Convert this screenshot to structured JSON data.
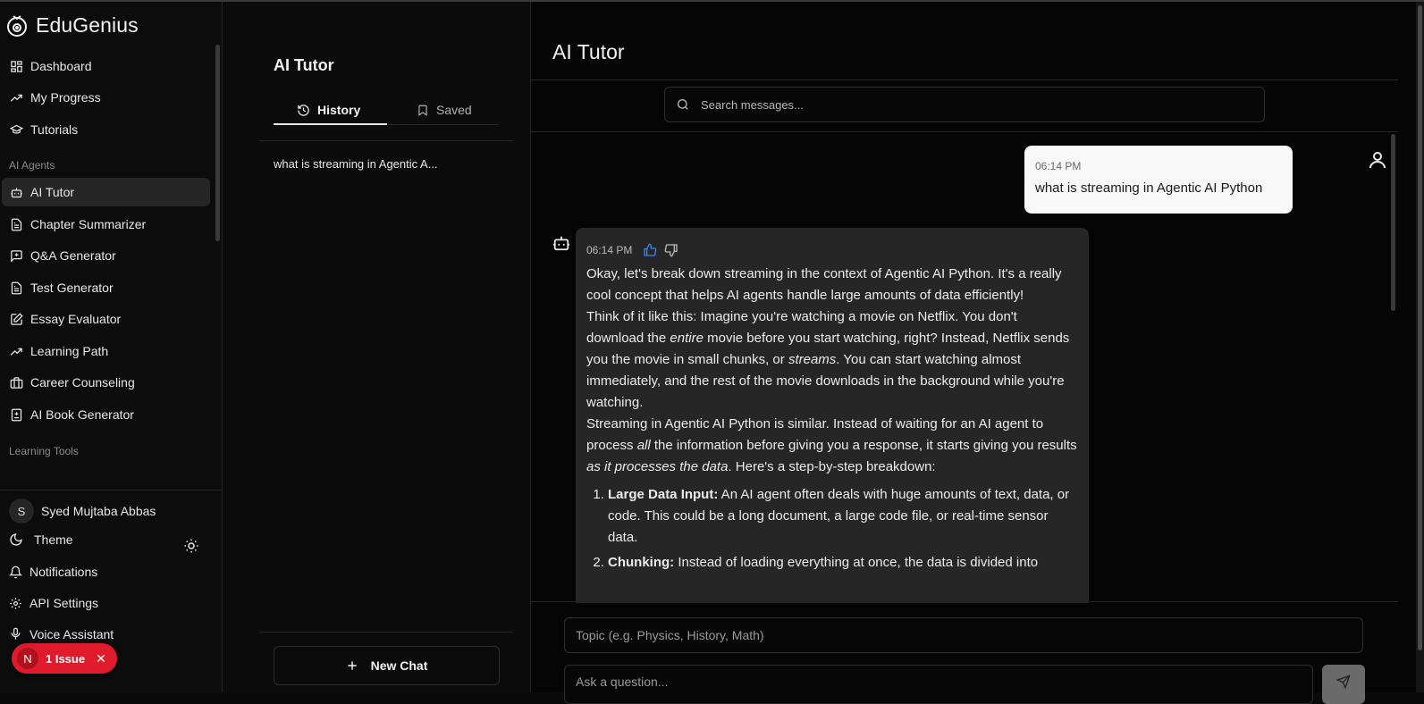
{
  "app": {
    "name": "EduGenius"
  },
  "sidebar": {
    "items_top": [
      {
        "label": "Dashboard",
        "icon": "grid-icon"
      },
      {
        "label": "My Progress",
        "icon": "trending-up-icon"
      },
      {
        "label": "Tutorials",
        "icon": "graduation-cap-icon"
      }
    ],
    "group_ai": "AI Agents",
    "items_ai": [
      {
        "label": "AI Tutor",
        "icon": "bot-icon",
        "active": true
      },
      {
        "label": "Chapter Summarizer",
        "icon": "document-icon"
      },
      {
        "label": "Q&A Generator",
        "icon": "message-plus-icon"
      },
      {
        "label": "Test Generator",
        "icon": "document-icon"
      },
      {
        "label": "Essay Evaluator",
        "icon": "pen-square-icon"
      },
      {
        "label": "Learning Path",
        "icon": "trending-up-icon"
      },
      {
        "label": "Career Counseling",
        "icon": "briefcase-icon"
      },
      {
        "label": "AI Book Generator",
        "icon": "book-plus-icon"
      }
    ],
    "group_tools": "Learning Tools",
    "user": {
      "initial": "S",
      "name": "Syed Mujtaba Abbas"
    },
    "theme_label": "Theme",
    "notifications_label": "Notifications",
    "api_settings_label": "API Settings",
    "voice_label": "Voice Assistant"
  },
  "issue_badge": {
    "initial": "N",
    "label": "1 Issue",
    "color": "#e01b2b"
  },
  "history_panel": {
    "title": "AI Tutor",
    "tabs": [
      {
        "label": "History",
        "active": true
      },
      {
        "label": "Saved"
      }
    ],
    "items": [
      "what is streaming in Agentic A..."
    ],
    "new_chat_label": "New Chat"
  },
  "chat": {
    "title": "AI Tutor",
    "search_placeholder": "Search messages...",
    "user_message": {
      "time": "06:14 PM",
      "text": "what is streaming in Agentic AI Python"
    },
    "bot_message": {
      "time": "06:14 PM",
      "p1": "Okay, let's break down streaming in the context of Agentic AI Python. It's a really cool concept that helps AI agents handle large amounts of data efficiently!",
      "p2_a": "Think of it like this: Imagine you're watching a movie on Netflix. You don't download the ",
      "p2_em1": "entire",
      "p2_b": " movie before you start watching, right? Instead, Netflix sends you the movie in small chunks, or ",
      "p2_em2": "streams",
      "p2_c": ". You can start watching almost immediately, and the rest of the movie downloads in the background while you're watching.",
      "p3_a": "Streaming in Agentic AI Python is similar. Instead of waiting for an AI agent to process ",
      "p3_em1": "all",
      "p3_b": " the information before giving you a response, it starts giving you results ",
      "p3_em2": "as it processes the data",
      "p3_c": ". Here's a step-by-step breakdown:",
      "list": [
        {
          "title": "Large Data Input:",
          "text": " An AI agent often deals with huge amounts of text, data, or code. This could be a long document, a large code file, or real-time sensor data."
        },
        {
          "title": "Chunking:",
          "text": " Instead of loading everything at once, the data is divided into"
        }
      ]
    },
    "topic_placeholder": "Topic (e.g. Physics, History, Math)",
    "ask_placeholder": "Ask a question..."
  },
  "colors": {
    "like_icon": "#3b82f6",
    "active_nav_bg": "#262626",
    "bot_bubble": "#262626"
  }
}
